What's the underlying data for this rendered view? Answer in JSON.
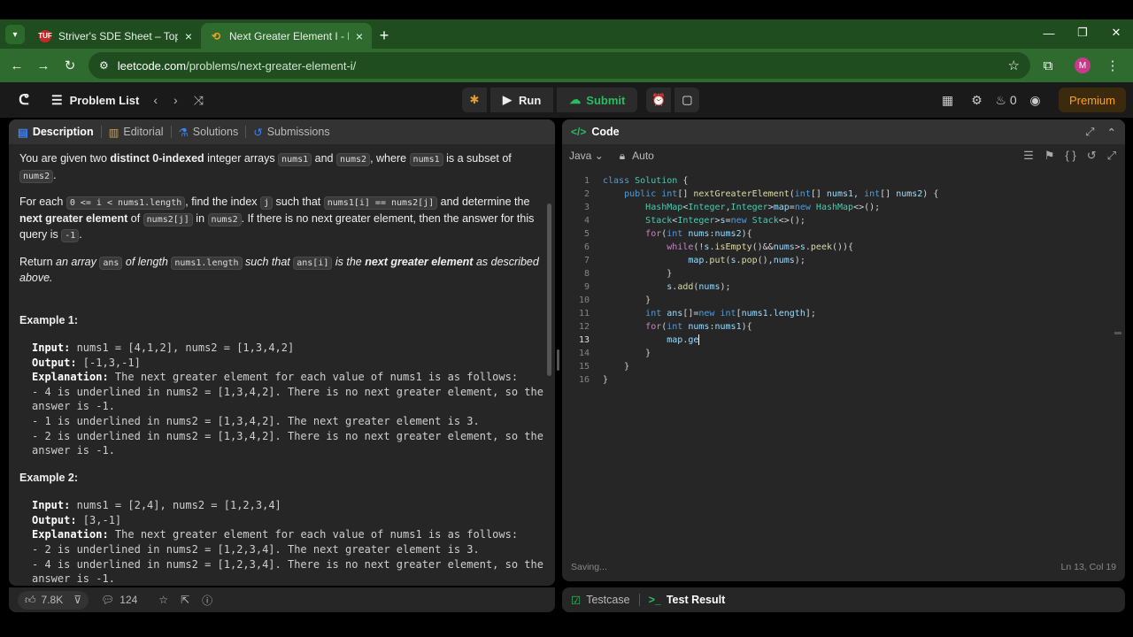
{
  "browser": {
    "tabs": [
      {
        "title": "Striver's SDE Sheet – Top Codin",
        "favicon_text": "TUF",
        "favicon_color": "#c62828"
      },
      {
        "title": "Next Greater Element I - LeetCo",
        "favicon_text": "",
        "favicon_color": "#f0a020"
      }
    ],
    "url_host": "leetcode.com",
    "url_path": "/problems/next-greater-element-i/",
    "profile_initial": "M"
  },
  "leetcode_header": {
    "problem_list_label": "Problem List",
    "run_label": "Run",
    "submit_label": "Submit",
    "streak_count": "0",
    "premium_label": "Premium"
  },
  "left_panel": {
    "tabs": [
      {
        "label": "Description"
      },
      {
        "label": "Editorial"
      },
      {
        "label": "Solutions"
      },
      {
        "label": "Submissions"
      }
    ],
    "p1": {
      "a": "You are given two ",
      "b": "distinct 0-indexed",
      "c": " integer arrays ",
      "code1": "nums1",
      "d": " and ",
      "code2": "nums2",
      "e": ", where ",
      "code3": "nums1",
      "f": " is a subset of ",
      "code4": "nums2",
      "g": "."
    },
    "p2": {
      "a": "For each ",
      "code1": "0 <= i < nums1.length",
      "b": ", find the index ",
      "code2": "j",
      "c": " such that ",
      "code3": "nums1[i] == nums2[j]",
      "d": " and determine the ",
      "e": "next greater element",
      "f": " of ",
      "code4": "nums2[j]",
      "g": " in ",
      "code5": "nums2",
      "h": ". If there is no next greater element, then the answer for this query is ",
      "code6": "-1",
      "i": "."
    },
    "p3": {
      "a": "Return ",
      "b": "an array ",
      "code1": "ans",
      "c": " of length ",
      "code2": "nums1.length",
      "d": " such that ",
      "code3": "ans[i]",
      "e": " is the ",
      "f": "next greater element",
      "g": " as described above."
    },
    "example1": {
      "title": "Example 1:",
      "input_label": "Input:",
      "input": " nums1 = [4,1,2], nums2 = [1,3,4,2]",
      "output_label": "Output:",
      "output": " [-1,3,-1]",
      "explanation_label": "Explanation:",
      "explanation": " The next greater element for each value of nums1 is as follows:\n- 4 is underlined in nums2 = [1,3,4,2]. There is no next greater element, so the\nanswer is -1.\n- 1 is underlined in nums2 = [1,3,4,2]. The next greater element is 3.\n- 2 is underlined in nums2 = [1,3,4,2]. There is no next greater element, so the\nanswer is -1."
    },
    "example2": {
      "title": "Example 2:",
      "input_label": "Input:",
      "input": " nums1 = [2,4], nums2 = [1,2,3,4]",
      "output_label": "Output:",
      "output": " [3,-1]",
      "explanation_label": "Explanation:",
      "explanation": " The next greater element for each value of nums1 is as follows:\n- 2 is underlined in nums2 = [1,2,3,4]. The next greater element is 3.\n- 4 is underlined in nums2 = [1,2,3,4]. There is no next greater element, so the\nanswer is -1."
    },
    "footer": {
      "likes": "7.8K",
      "comments": "124"
    }
  },
  "code_panel": {
    "title": "Code",
    "language": "Java",
    "autosave": "Auto",
    "lines": [
      "class Solution {",
      "    public int[] nextGreaterElement(int[] nums1, int[] nums2) {",
      "        HashMap<Integer,Integer>map=new HashMap<>();",
      "        Stack<Integer>s=new Stack<>();",
      "        for(int nums:nums2){",
      "            while(!s.isEmpty()&&nums>s.peek()){",
      "                map.put(s.pop(),nums);",
      "            }",
      "            s.add(nums);",
      "        }",
      "        int ans[]=new int[nums1.length];",
      "        for(int nums:nums1){",
      "            map.ge",
      "        }",
      "    }",
      "}"
    ],
    "line_numbers": [
      "1",
      "2",
      "3",
      "4",
      "5",
      "6",
      "7",
      "8",
      "9",
      "10",
      "11",
      "12",
      "13",
      "14",
      "15",
      "16"
    ],
    "status_left": "Saving...",
    "status_right": "Ln 13, Col 19"
  },
  "bottom_panel": {
    "testcase_label": "Testcase",
    "test_result_label": "Test Result"
  }
}
